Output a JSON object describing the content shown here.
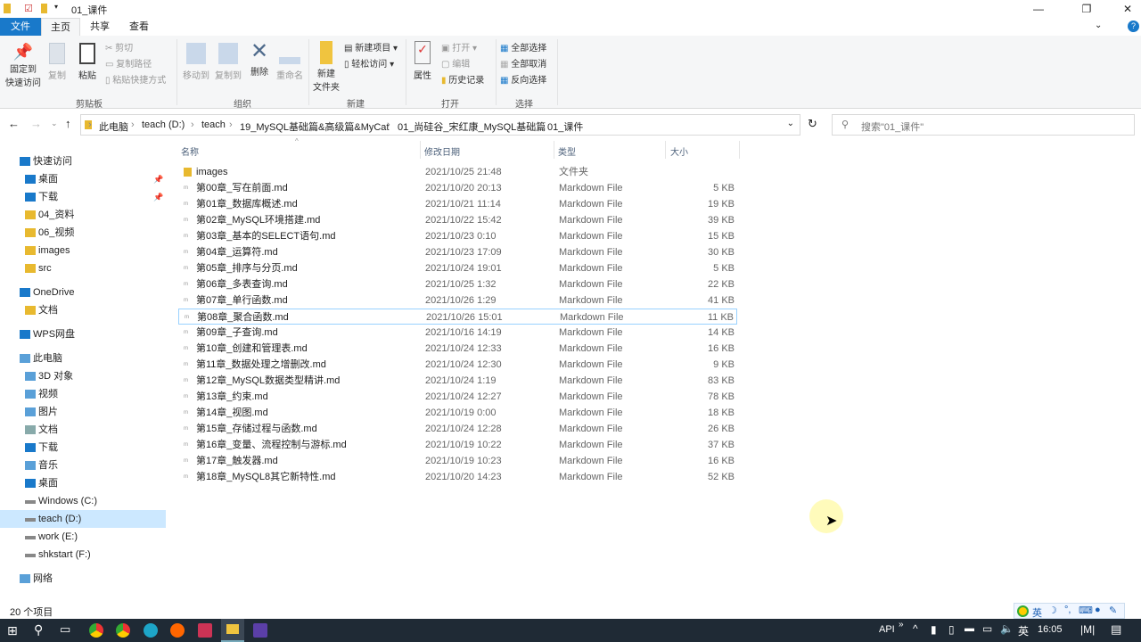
{
  "window": {
    "title": "01_课件",
    "min": "—",
    "max": "❐",
    "close": "✕"
  },
  "tabs": {
    "file": "文件",
    "home": "主页",
    "share": "共享",
    "view": "查看"
  },
  "ribbon": {
    "pin": "固定到\n快速访问",
    "copy": "复制",
    "paste": "粘贴",
    "cut": "剪切",
    "copy_path": "复制路径",
    "paste_shortcut": "粘贴快捷方式",
    "clipboard": "剪贴板",
    "move_to": "移动到",
    "copy_to": "复制到",
    "delete": "删除",
    "rename": "重命名",
    "organize": "组织",
    "new_folder": "新建\n文件夹",
    "new_item": "新建项目 ▾",
    "easy_access": "轻松访问 ▾",
    "new": "新建",
    "properties": "属性",
    "open": "打开 ▾",
    "edit": "编辑",
    "history": "历史记录",
    "open_group": "打开",
    "select_all": "全部选择",
    "select_none": "全部取消",
    "invert": "反向选择",
    "select": "选择"
  },
  "address": {
    "crumbs": [
      "此电脑",
      "teach (D:)",
      "teach",
      "19_MySQL基础篇&高级篇&MyCat",
      "01_尚硅谷_宋红康_MySQL基础篇",
      "01_课件"
    ],
    "search_placeholder": "搜索\"01_课件\""
  },
  "sidebar": [
    {
      "label": "快速访问",
      "icon": "star-icon",
      "indent": 0,
      "pin": false
    },
    {
      "label": "桌面",
      "icon": "desktop-icon",
      "indent": 1,
      "pin": true
    },
    {
      "label": "下载",
      "icon": "download-icon",
      "indent": 1,
      "pin": true
    },
    {
      "label": "04_资料",
      "icon": "folder-icon",
      "indent": 1
    },
    {
      "label": "06_视频",
      "icon": "folder-icon",
      "indent": 1
    },
    {
      "label": "images",
      "icon": "folder-icon",
      "indent": 1
    },
    {
      "label": "src",
      "icon": "folder-icon",
      "indent": 1
    },
    {
      "label": "OneDrive",
      "icon": "cloud-icon",
      "indent": 0,
      "gap": true
    },
    {
      "label": "文档",
      "icon": "folder-icon",
      "indent": 1
    },
    {
      "label": "WPS网盘",
      "icon": "cloud-icon",
      "indent": 0,
      "gap": true
    },
    {
      "label": "此电脑",
      "icon": "computer-icon",
      "indent": 0,
      "gap": true
    },
    {
      "label": "3D 对象",
      "icon": "cube-icon",
      "indent": 1
    },
    {
      "label": "视频",
      "icon": "video-icon",
      "indent": 1
    },
    {
      "label": "图片",
      "icon": "picture-icon",
      "indent": 1
    },
    {
      "label": "文档",
      "icon": "document-icon",
      "indent": 1
    },
    {
      "label": "下载",
      "icon": "download-icon",
      "indent": 1
    },
    {
      "label": "音乐",
      "icon": "music-icon",
      "indent": 1
    },
    {
      "label": "桌面",
      "icon": "desktop-icon",
      "indent": 1
    },
    {
      "label": "Windows (C:)",
      "icon": "drive-icon",
      "indent": 1
    },
    {
      "label": "teach (D:)",
      "icon": "drive-icon",
      "indent": 1,
      "selected": true
    },
    {
      "label": "work (E:)",
      "icon": "drive-icon",
      "indent": 1
    },
    {
      "label": "shkstart (F:)",
      "icon": "drive-icon",
      "indent": 1
    },
    {
      "label": "网络",
      "icon": "network-icon",
      "indent": 0,
      "gap": true
    }
  ],
  "columns": {
    "name": "名称",
    "date": "修改日期",
    "type": "类型",
    "size": "大小"
  },
  "files": [
    {
      "name": "images",
      "date": "2021/10/25 21:48",
      "type": "文件夹",
      "size": "",
      "folder": true
    },
    {
      "name": "第00章_写在前面.md",
      "date": "2021/10/20 20:13",
      "type": "Markdown File",
      "size": "5 KB"
    },
    {
      "name": "第01章_数据库概述.md",
      "date": "2021/10/21 11:14",
      "type": "Markdown File",
      "size": "19 KB"
    },
    {
      "name": "第02章_MySQL环境搭建.md",
      "date": "2021/10/22 15:42",
      "type": "Markdown File",
      "size": "39 KB"
    },
    {
      "name": "第03章_基本的SELECT语句.md",
      "date": "2021/10/23 0:10",
      "type": "Markdown File",
      "size": "15 KB"
    },
    {
      "name": "第04章_运算符.md",
      "date": "2021/10/23 17:09",
      "type": "Markdown File",
      "size": "30 KB"
    },
    {
      "name": "第05章_排序与分页.md",
      "date": "2021/10/24 19:01",
      "type": "Markdown File",
      "size": "5 KB"
    },
    {
      "name": "第06章_多表查询.md",
      "date": "2021/10/25 1:32",
      "type": "Markdown File",
      "size": "22 KB"
    },
    {
      "name": "第07章_单行函数.md",
      "date": "2021/10/26 1:29",
      "type": "Markdown File",
      "size": "41 KB"
    },
    {
      "name": "第08章_聚合函数.md",
      "date": "2021/10/26 15:01",
      "type": "Markdown File",
      "size": "11 KB",
      "selected": true
    },
    {
      "name": "第09章_子查询.md",
      "date": "2021/10/16 14:19",
      "type": "Markdown File",
      "size": "14 KB"
    },
    {
      "name": "第10章_创建和管理表.md",
      "date": "2021/10/24 12:33",
      "type": "Markdown File",
      "size": "16 KB"
    },
    {
      "name": "第11章_数据处理之增删改.md",
      "date": "2021/10/24 12:30",
      "type": "Markdown File",
      "size": "9 KB"
    },
    {
      "name": "第12章_MySQL数据类型精讲.md",
      "date": "2021/10/24 1:19",
      "type": "Markdown File",
      "size": "83 KB"
    },
    {
      "name": "第13章_约束.md",
      "date": "2021/10/24 12:27",
      "type": "Markdown File",
      "size": "78 KB"
    },
    {
      "name": "第14章_视图.md",
      "date": "2021/10/19 0:00",
      "type": "Markdown File",
      "size": "18 KB"
    },
    {
      "name": "第15章_存储过程与函数.md",
      "date": "2021/10/24 12:28",
      "type": "Markdown File",
      "size": "26 KB"
    },
    {
      "name": "第16章_变量、流程控制与游标.md",
      "date": "2021/10/19 10:22",
      "type": "Markdown File",
      "size": "37 KB"
    },
    {
      "name": "第17章_触发器.md",
      "date": "2021/10/19 10:23",
      "type": "Markdown File",
      "size": "16 KB"
    },
    {
      "name": "第18章_MySQL8其它新特性.md",
      "date": "2021/10/20 14:23",
      "type": "Markdown File",
      "size": "52 KB"
    }
  ],
  "status": "20 个项目",
  "ime": {
    "label": "英"
  },
  "taskbar": {
    "api": "API",
    "lang": "英",
    "time": "16:05"
  }
}
